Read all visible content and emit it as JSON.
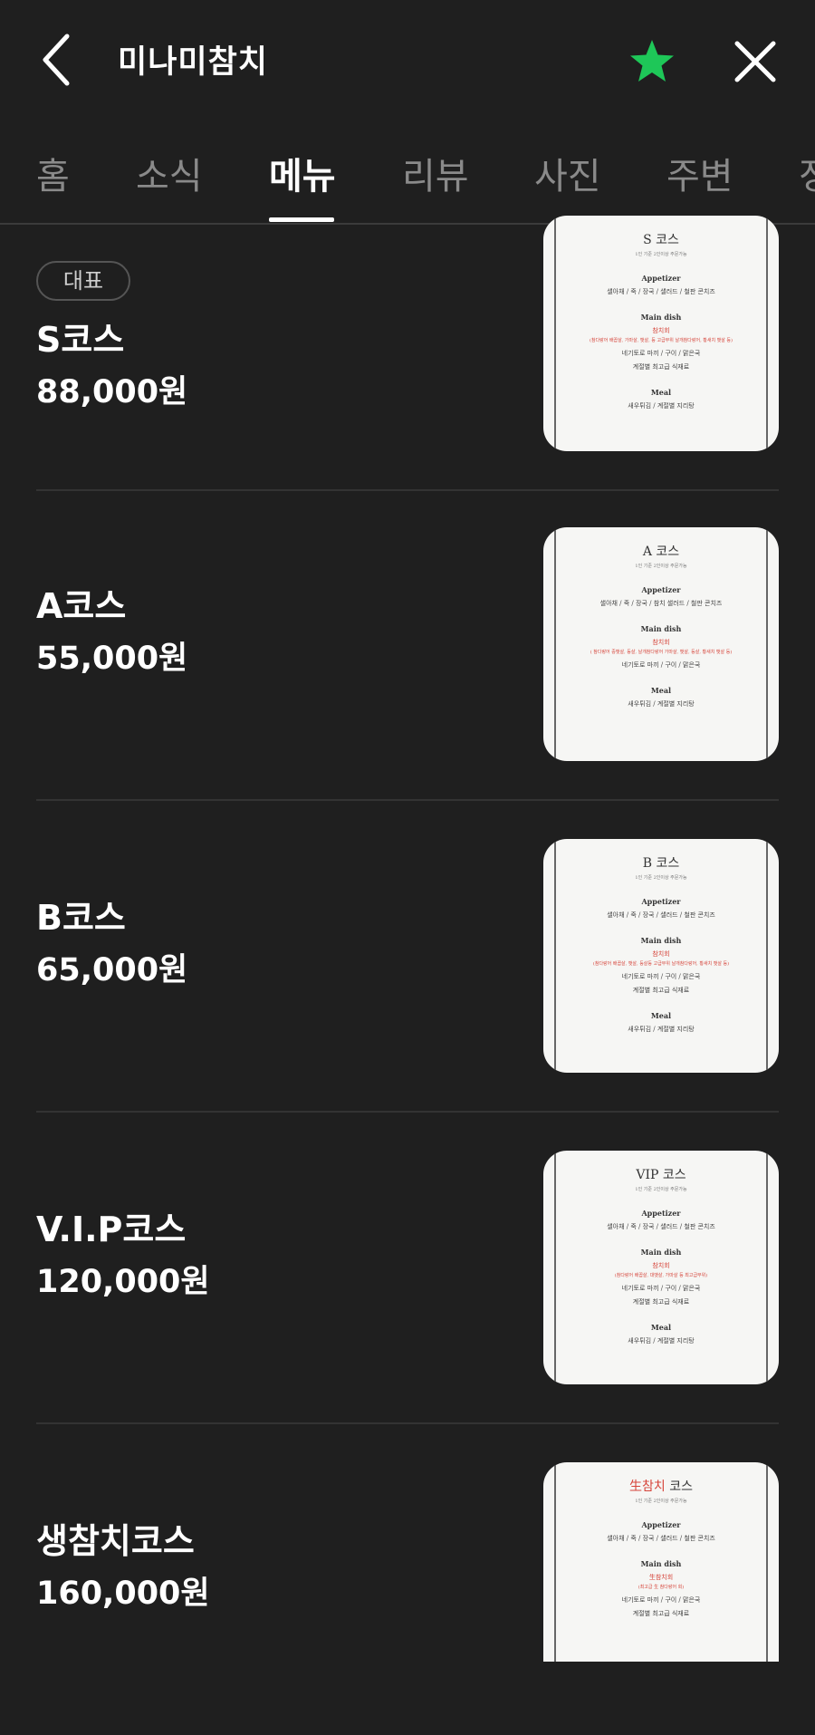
{
  "header": {
    "title": "미나미참치",
    "star_color": "#1ec758"
  },
  "tabs": [
    {
      "label": "홈",
      "active": false
    },
    {
      "label": "소식",
      "active": false
    },
    {
      "label": "메뉴",
      "active": true
    },
    {
      "label": "리뷰",
      "active": false
    },
    {
      "label": "사진",
      "active": false
    },
    {
      "label": "주변",
      "active": false
    },
    {
      "label": "정",
      "active": false
    }
  ],
  "menu": [
    {
      "badge": "대표",
      "name": "S코스",
      "price": "88,000원",
      "thumb": {
        "title": "S 코스",
        "sub": "1인 기준 2인이상 주문가능",
        "appetizer_head": "Appetizer",
        "appetizer": "샐아채 / 죽 / 장국 / 샐러드 / 철판 콘치즈",
        "main_head": "Main dish",
        "main_red": "참치회",
        "main_red_note": "(참다랑어 배꼽살, 가마살, 뱃살, 등 고급부위 날개참다랑어, 황새치 뱃살 등)",
        "main_line1": "네기토로 마끼 / 구이 / 맑은국",
        "main_line2": "계절별 최고급 식재료",
        "meal_head": "Meal",
        "meal": "새우튀김 / 계절별 지리탕"
      }
    },
    {
      "badge": "",
      "name": "A코스",
      "price": "55,000원",
      "thumb": {
        "title": "A 코스",
        "sub": "1인 기준 2인이상 주문가능",
        "appetizer_head": "Appetizer",
        "appetizer": "샐아채 / 죽 / 장국 / 참치 샐러드 / 철판 콘치즈",
        "main_head": "Main dish",
        "main_red": "참치회",
        "main_red_note": "( 참다랑어 중뱃살, 등살, 날개참다랑어 가마살, 뱃살, 등살, 황새치 뱃살 등)",
        "main_line1": "네기토로 마끼 / 구이 / 맑은국",
        "main_line2": "",
        "meal_head": "Meal",
        "meal": "새우튀김 / 계절별 지리탕"
      }
    },
    {
      "badge": "",
      "name": "B코스",
      "price": "65,000원",
      "thumb": {
        "title": "B 코스",
        "sub": "1인 기준 2인이상 주문가능",
        "appetizer_head": "Appetizer",
        "appetizer": "샐아채 / 죽 / 장국 / 샐러드 / 철판 콘치즈",
        "main_head": "Main dish",
        "main_red": "참치회",
        "main_red_note": "(참다랑어 배꼽살, 뱃살, 등살등 고급부위 날개참다랑어, 황새치 뱃살 등)",
        "main_line1": "네기토로 마끼 / 구이 / 맑은국",
        "main_line2": "계절별 최고급 식재료",
        "meal_head": "Meal",
        "meal": "새우튀김 / 계절별 지리탕"
      }
    },
    {
      "badge": "",
      "name": "V.I.P코스",
      "price": "120,000원",
      "thumb": {
        "title": "VIP 코스",
        "sub": "1인 기준 2인이상 주문가능",
        "appetizer_head": "Appetizer",
        "appetizer": "샐아채 / 죽 / 장국 / 샐러드 / 철판 콘치즈",
        "main_head": "Main dish",
        "main_red": "참치회",
        "main_red_note": "(참다랑어 배꼽살, 대뱃살, 가마살 등 최고급부위)",
        "main_line1": "네기토로 마끼 / 구이 / 맑은국",
        "main_line2": "계절별 최고급 식재료",
        "meal_head": "Meal",
        "meal": "새우튀김 / 계절별 지리탕"
      }
    },
    {
      "badge": "",
      "name": "생참치코스",
      "price": "160,000원",
      "thumb": {
        "title_red": "生참치",
        "title": "코스",
        "sub": "1인 기준 2인이상 주문가능",
        "appetizer_head": "Appetizer",
        "appetizer": "샐아채 / 죽 / 장국 / 샐러드 / 철판 콘치즈",
        "main_head": "Main dish",
        "main_red": "生참치회",
        "main_red_note": "(최고급 生 참다랑어 회)",
        "main_line1": "네기토로 마끼 / 구이 / 맑은국",
        "main_line2": "계절별 최고급 식재료",
        "meal_head": "",
        "meal": ""
      }
    }
  ]
}
